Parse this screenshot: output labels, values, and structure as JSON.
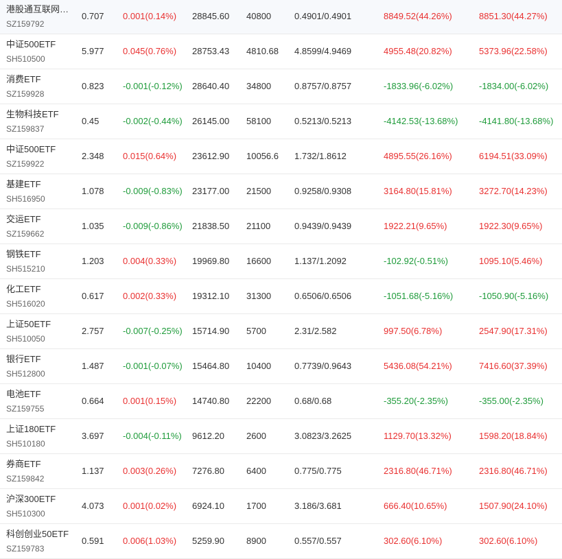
{
  "colors": {
    "up": "#e93030",
    "down": "#1e9b3a"
  },
  "rows": [
    {
      "name": "港股通互联网…",
      "code": "SZ159792",
      "price": "0.707",
      "change": "0.001(0.14%)",
      "change_dir": "up",
      "value": "28845.60",
      "qty": "40800",
      "cost": "0.4901/0.4901",
      "pl1": "8849.52(44.26%)",
      "pl1_dir": "up",
      "pl2": "8851.30(44.27%)",
      "pl2_dir": "up"
    },
    {
      "name": "中证500ETF",
      "code": "SH510500",
      "price": "5.977",
      "change": "0.045(0.76%)",
      "change_dir": "up",
      "value": "28753.43",
      "qty": "4810.68",
      "cost": "4.8599/4.9469",
      "pl1": "4955.48(20.82%)",
      "pl1_dir": "up",
      "pl2": "5373.96(22.58%)",
      "pl2_dir": "up"
    },
    {
      "name": "消费ETF",
      "code": "SZ159928",
      "price": "0.823",
      "change": "-0.001(-0.12%)",
      "change_dir": "down",
      "value": "28640.40",
      "qty": "34800",
      "cost": "0.8757/0.8757",
      "pl1": "-1833.96(-6.02%)",
      "pl1_dir": "down",
      "pl2": "-1834.00(-6.02%)",
      "pl2_dir": "down"
    },
    {
      "name": "生物科技ETF",
      "code": "SZ159837",
      "price": "0.45",
      "change": "-0.002(-0.44%)",
      "change_dir": "down",
      "value": "26145.00",
      "qty": "58100",
      "cost": "0.5213/0.5213",
      "pl1": "-4142.53(-13.68%)",
      "pl1_dir": "down",
      "pl2": "-4141.80(-13.68%)",
      "pl2_dir": "down"
    },
    {
      "name": "中证500ETF",
      "code": "SZ159922",
      "price": "2.348",
      "change": "0.015(0.64%)",
      "change_dir": "up",
      "value": "23612.90",
      "qty": "10056.6",
      "cost": "1.732/1.8612",
      "pl1": "4895.55(26.16%)",
      "pl1_dir": "up",
      "pl2": "6194.51(33.09%)",
      "pl2_dir": "up"
    },
    {
      "name": "基建ETF",
      "code": "SH516950",
      "price": "1.078",
      "change": "-0.009(-0.83%)",
      "change_dir": "down",
      "value": "23177.00",
      "qty": "21500",
      "cost": "0.9258/0.9308",
      "pl1": "3164.80(15.81%)",
      "pl1_dir": "up",
      "pl2": "3272.70(14.23%)",
      "pl2_dir": "up"
    },
    {
      "name": "交运ETF",
      "code": "SZ159662",
      "price": "1.035",
      "change": "-0.009(-0.86%)",
      "change_dir": "down",
      "value": "21838.50",
      "qty": "21100",
      "cost": "0.9439/0.9439",
      "pl1": "1922.21(9.65%)",
      "pl1_dir": "up",
      "pl2": "1922.30(9.65%)",
      "pl2_dir": "up"
    },
    {
      "name": "钢铁ETF",
      "code": "SH515210",
      "price": "1.203",
      "change": "0.004(0.33%)",
      "change_dir": "up",
      "value": "19969.80",
      "qty": "16600",
      "cost": "1.137/1.2092",
      "pl1": "-102.92(-0.51%)",
      "pl1_dir": "down",
      "pl2": "1095.10(5.46%)",
      "pl2_dir": "up"
    },
    {
      "name": "化工ETF",
      "code": "SH516020",
      "price": "0.617",
      "change": "0.002(0.33%)",
      "change_dir": "up",
      "value": "19312.10",
      "qty": "31300",
      "cost": "0.6506/0.6506",
      "pl1": "-1051.68(-5.16%)",
      "pl1_dir": "down",
      "pl2": "-1050.90(-5.16%)",
      "pl2_dir": "down"
    },
    {
      "name": "上证50ETF",
      "code": "SH510050",
      "price": "2.757",
      "change": "-0.007(-0.25%)",
      "change_dir": "down",
      "value": "15714.90",
      "qty": "5700",
      "cost": "2.31/2.582",
      "pl1": "997.50(6.78%)",
      "pl1_dir": "up",
      "pl2": "2547.90(17.31%)",
      "pl2_dir": "up"
    },
    {
      "name": "银行ETF",
      "code": "SH512800",
      "price": "1.487",
      "change": "-0.001(-0.07%)",
      "change_dir": "down",
      "value": "15464.80",
      "qty": "10400",
      "cost": "0.7739/0.9643",
      "pl1": "5436.08(54.21%)",
      "pl1_dir": "up",
      "pl2": "7416.60(37.39%)",
      "pl2_dir": "up"
    },
    {
      "name": "电池ETF",
      "code": "SZ159755",
      "price": "0.664",
      "change": "0.001(0.15%)",
      "change_dir": "up",
      "value": "14740.80",
      "qty": "22200",
      "cost": "0.68/0.68",
      "pl1": "-355.20(-2.35%)",
      "pl1_dir": "down",
      "pl2": "-355.00(-2.35%)",
      "pl2_dir": "down"
    },
    {
      "name": "上证180ETF",
      "code": "SH510180",
      "price": "3.697",
      "change": "-0.004(-0.11%)",
      "change_dir": "down",
      "value": "9612.20",
      "qty": "2600",
      "cost": "3.0823/3.2625",
      "pl1": "1129.70(13.32%)",
      "pl1_dir": "up",
      "pl2": "1598.20(18.84%)",
      "pl2_dir": "up"
    },
    {
      "name": "券商ETF",
      "code": "SZ159842",
      "price": "1.137",
      "change": "0.003(0.26%)",
      "change_dir": "up",
      "value": "7276.80",
      "qty": "6400",
      "cost": "0.775/0.775",
      "pl1": "2316.80(46.71%)",
      "pl1_dir": "up",
      "pl2": "2316.80(46.71%)",
      "pl2_dir": "up"
    },
    {
      "name": "沪深300ETF",
      "code": "SH510300",
      "price": "4.073",
      "change": "0.001(0.02%)",
      "change_dir": "up",
      "value": "6924.10",
      "qty": "1700",
      "cost": "3.186/3.681",
      "pl1": "666.40(10.65%)",
      "pl1_dir": "up",
      "pl2": "1507.90(24.10%)",
      "pl2_dir": "up"
    },
    {
      "name": "科创创业50ETF",
      "code": "SZ159783",
      "price": "0.591",
      "change": "0.006(1.03%)",
      "change_dir": "up",
      "value": "5259.90",
      "qty": "8900",
      "cost": "0.557/0.557",
      "pl1": "302.60(6.10%)",
      "pl1_dir": "up",
      "pl2": "302.60(6.10%)",
      "pl2_dir": "up"
    }
  ]
}
